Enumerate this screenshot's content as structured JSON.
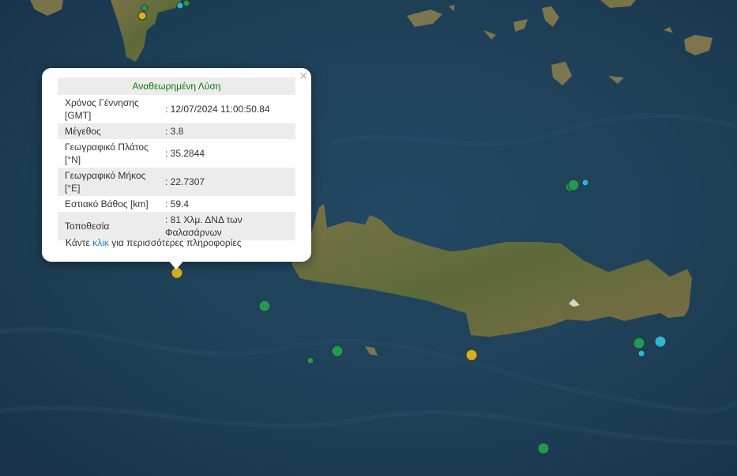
{
  "popup": {
    "title": "Αναθεωρημένη Λύση",
    "close_label": "×",
    "rows": [
      {
        "label": "Χρόνος Γέννησης [GMT]",
        "value": ": 12/07/2024 11:00:50.84"
      },
      {
        "label": "Μέγεθος",
        "value": ": 3.8"
      },
      {
        "label": "Γεωγραφικό Πλάτος [°N]",
        "value": ": 35.2844"
      },
      {
        "label": "Γεωγραφικό Μήκος [°E]",
        "value": ": 22.7307"
      },
      {
        "label": "Εστιακό Βάθος [km]",
        "value": ": 59.4"
      },
      {
        "label": "Τοποθεσία",
        "value": ": 81 Χλμ. ΔΝΔ των Φαλασάρνων"
      }
    ],
    "footer_pre": "Κάντε ",
    "footer_link": "κλικ",
    "footer_post": " για περισσότερες πληροφορίες"
  },
  "colors": {
    "sea": "#1e3d52",
    "land": "#6b6a3e",
    "marker_green": "#1e9a55",
    "marker_yellow": "#d4b21e",
    "marker_cyan": "#28b9d6"
  }
}
